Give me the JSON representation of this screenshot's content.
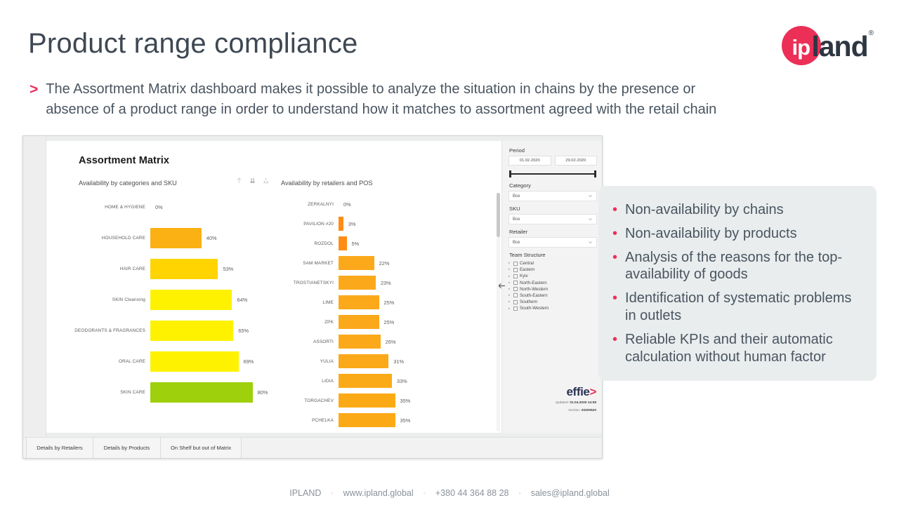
{
  "header": {
    "title": "Product range compliance",
    "logo": {
      "mark_text": "ip",
      "word": "land",
      "registered": "®",
      "brand_color": "#ec2f57"
    }
  },
  "lead": {
    "bullet": ">",
    "line1": "The Assortment Matrix dashboard makes it possible to analyze the situation in chains by the presence or",
    "line2": "absence of a product range in order to understand how it matches to assortment agreed with the retail chain"
  },
  "dashboard": {
    "title": "Assortment Matrix",
    "subtitle_left": "Availability by categories and SKU",
    "subtitle_right": "Availability by retailers and POS",
    "visual_icons": [
      "drill-up-icon",
      "expand-all-icon",
      "drill-down-icon"
    ],
    "collapse_arrow": "←",
    "filters": {
      "period_label": "Period",
      "period_from": "01.02.2020",
      "period_to": "29.02.2020",
      "category_label": "Category",
      "category_value": "Все",
      "sku_label": "SKU",
      "sku_value": "Все",
      "retailer_label": "Retailer",
      "retailer_value": "Все",
      "team_label": "Team Structure",
      "teams": [
        "Central",
        "Eastern",
        "Kyiv",
        "North-Eastern",
        "North-Western",
        "South-Eastern",
        "Southern",
        "South-Western"
      ]
    },
    "brand": {
      "name": "effie",
      "arrow": ">",
      "updated_label": "Updated:",
      "updated_value": "01.04.2020 14:08",
      "version_label": "Version:",
      "version_value": "20200520"
    },
    "tabs": [
      "Details by Retailers",
      "Details by Products",
      "On Shelf but out of Matrix"
    ]
  },
  "chart_data": [
    {
      "type": "bar",
      "orientation": "horizontal",
      "title": "Availability by categories and SKU",
      "xlabel": "",
      "ylabel": "",
      "xlim": [
        0,
        100
      ],
      "categories": [
        "HOME & HYGIENE",
        "HOUSEHOLD CARE",
        "HAIR CARE",
        "SKIN Cleansing",
        "DEODORANTS & FRAGRANCES",
        "ORAL CARE",
        "SKIN CARE"
      ],
      "values": [
        0,
        40,
        53,
        64,
        65,
        69,
        80
      ],
      "labels": [
        "0%",
        "40%",
        "53%",
        "64%",
        "65%",
        "69%",
        "80%"
      ],
      "colors": [
        "#ffffff",
        "#fbb014",
        "#ffd400",
        "#fff200",
        "#fff200",
        "#fff200",
        "#9fd00c"
      ],
      "grid": false,
      "legend": "none"
    },
    {
      "type": "bar",
      "orientation": "horizontal",
      "title": "Availability by retailers and POS",
      "xlabel": "",
      "ylabel": "",
      "xlim": [
        0,
        100
      ],
      "categories": [
        "ZERKALNYI",
        "PAVILION #20",
        "ROZDOL",
        "SAM MARKET",
        "TROSTIANETSKYI",
        "LIME",
        "ZPK",
        "ASSORTI",
        "YULIA",
        "LIDIA",
        "TORGACHEV",
        "PCHELKA"
      ],
      "values": [
        0,
        3,
        5,
        22,
        23,
        25,
        25,
        26,
        31,
        33,
        35,
        35
      ],
      "labels": [
        "0%",
        "3%",
        "5%",
        "22%",
        "23%",
        "25%",
        "25%",
        "26%",
        "31%",
        "33%",
        "35%",
        "35%"
      ],
      "colors": [
        "#ffffff",
        "#ff8c14",
        "#ff8c14",
        "#fba91b",
        "#fba91b",
        "#fba91b",
        "#fba91b",
        "#fba91b",
        "#fba919",
        "#fbaa17",
        "#fbaa15",
        "#fbaa15"
      ],
      "grid": false,
      "legend": "none"
    }
  ],
  "benefits": {
    "items": [
      "Non-availability by chains",
      "Non-availability by products",
      "Analysis of the reasons for the top-availability of goods",
      "Identification of systematic problems in outlets",
      "Reliable KPIs and their automatic calculation without human factor"
    ]
  },
  "footer": {
    "company": "IPLAND",
    "website": "www.ipland.global",
    "phone": "+380 44 364 88 28",
    "email": "sales@ipland.global",
    "separator": "◦"
  }
}
